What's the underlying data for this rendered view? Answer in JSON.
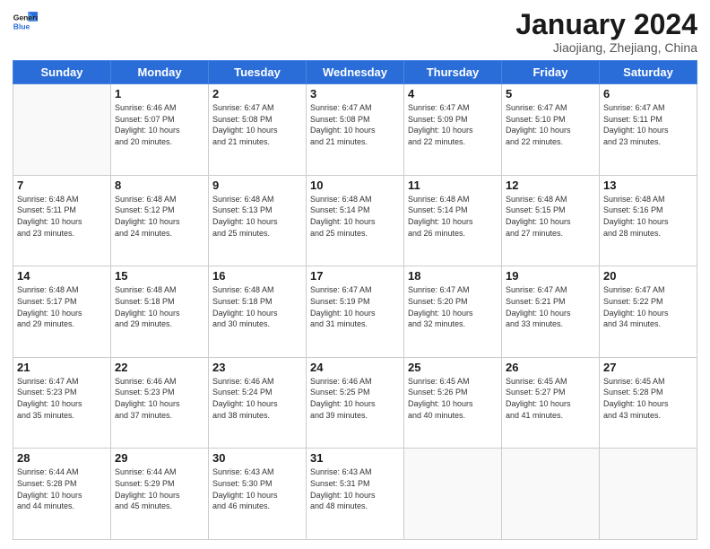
{
  "header": {
    "logo_line1": "General",
    "logo_line2": "Blue",
    "month_title": "January 2024",
    "location": "Jiaojiang, Zhejiang, China"
  },
  "days_of_week": [
    "Sunday",
    "Monday",
    "Tuesday",
    "Wednesday",
    "Thursday",
    "Friday",
    "Saturday"
  ],
  "weeks": [
    [
      {
        "day": "",
        "info": ""
      },
      {
        "day": "1",
        "info": "Sunrise: 6:46 AM\nSunset: 5:07 PM\nDaylight: 10 hours\nand 20 minutes."
      },
      {
        "day": "2",
        "info": "Sunrise: 6:47 AM\nSunset: 5:08 PM\nDaylight: 10 hours\nand 21 minutes."
      },
      {
        "day": "3",
        "info": "Sunrise: 6:47 AM\nSunset: 5:08 PM\nDaylight: 10 hours\nand 21 minutes."
      },
      {
        "day": "4",
        "info": "Sunrise: 6:47 AM\nSunset: 5:09 PM\nDaylight: 10 hours\nand 22 minutes."
      },
      {
        "day": "5",
        "info": "Sunrise: 6:47 AM\nSunset: 5:10 PM\nDaylight: 10 hours\nand 22 minutes."
      },
      {
        "day": "6",
        "info": "Sunrise: 6:47 AM\nSunset: 5:11 PM\nDaylight: 10 hours\nand 23 minutes."
      }
    ],
    [
      {
        "day": "7",
        "info": "Sunrise: 6:48 AM\nSunset: 5:11 PM\nDaylight: 10 hours\nand 23 minutes."
      },
      {
        "day": "8",
        "info": "Sunrise: 6:48 AM\nSunset: 5:12 PM\nDaylight: 10 hours\nand 24 minutes."
      },
      {
        "day": "9",
        "info": "Sunrise: 6:48 AM\nSunset: 5:13 PM\nDaylight: 10 hours\nand 25 minutes."
      },
      {
        "day": "10",
        "info": "Sunrise: 6:48 AM\nSunset: 5:14 PM\nDaylight: 10 hours\nand 25 minutes."
      },
      {
        "day": "11",
        "info": "Sunrise: 6:48 AM\nSunset: 5:14 PM\nDaylight: 10 hours\nand 26 minutes."
      },
      {
        "day": "12",
        "info": "Sunrise: 6:48 AM\nSunset: 5:15 PM\nDaylight: 10 hours\nand 27 minutes."
      },
      {
        "day": "13",
        "info": "Sunrise: 6:48 AM\nSunset: 5:16 PM\nDaylight: 10 hours\nand 28 minutes."
      }
    ],
    [
      {
        "day": "14",
        "info": "Sunrise: 6:48 AM\nSunset: 5:17 PM\nDaylight: 10 hours\nand 29 minutes."
      },
      {
        "day": "15",
        "info": "Sunrise: 6:48 AM\nSunset: 5:18 PM\nDaylight: 10 hours\nand 29 minutes."
      },
      {
        "day": "16",
        "info": "Sunrise: 6:48 AM\nSunset: 5:18 PM\nDaylight: 10 hours\nand 30 minutes."
      },
      {
        "day": "17",
        "info": "Sunrise: 6:47 AM\nSunset: 5:19 PM\nDaylight: 10 hours\nand 31 minutes."
      },
      {
        "day": "18",
        "info": "Sunrise: 6:47 AM\nSunset: 5:20 PM\nDaylight: 10 hours\nand 32 minutes."
      },
      {
        "day": "19",
        "info": "Sunrise: 6:47 AM\nSunset: 5:21 PM\nDaylight: 10 hours\nand 33 minutes."
      },
      {
        "day": "20",
        "info": "Sunrise: 6:47 AM\nSunset: 5:22 PM\nDaylight: 10 hours\nand 34 minutes."
      }
    ],
    [
      {
        "day": "21",
        "info": "Sunrise: 6:47 AM\nSunset: 5:23 PM\nDaylight: 10 hours\nand 35 minutes."
      },
      {
        "day": "22",
        "info": "Sunrise: 6:46 AM\nSunset: 5:23 PM\nDaylight: 10 hours\nand 37 minutes."
      },
      {
        "day": "23",
        "info": "Sunrise: 6:46 AM\nSunset: 5:24 PM\nDaylight: 10 hours\nand 38 minutes."
      },
      {
        "day": "24",
        "info": "Sunrise: 6:46 AM\nSunset: 5:25 PM\nDaylight: 10 hours\nand 39 minutes."
      },
      {
        "day": "25",
        "info": "Sunrise: 6:45 AM\nSunset: 5:26 PM\nDaylight: 10 hours\nand 40 minutes."
      },
      {
        "day": "26",
        "info": "Sunrise: 6:45 AM\nSunset: 5:27 PM\nDaylight: 10 hours\nand 41 minutes."
      },
      {
        "day": "27",
        "info": "Sunrise: 6:45 AM\nSunset: 5:28 PM\nDaylight: 10 hours\nand 43 minutes."
      }
    ],
    [
      {
        "day": "28",
        "info": "Sunrise: 6:44 AM\nSunset: 5:28 PM\nDaylight: 10 hours\nand 44 minutes."
      },
      {
        "day": "29",
        "info": "Sunrise: 6:44 AM\nSunset: 5:29 PM\nDaylight: 10 hours\nand 45 minutes."
      },
      {
        "day": "30",
        "info": "Sunrise: 6:43 AM\nSunset: 5:30 PM\nDaylight: 10 hours\nand 46 minutes."
      },
      {
        "day": "31",
        "info": "Sunrise: 6:43 AM\nSunset: 5:31 PM\nDaylight: 10 hours\nand 48 minutes."
      },
      {
        "day": "",
        "info": ""
      },
      {
        "day": "",
        "info": ""
      },
      {
        "day": "",
        "info": ""
      }
    ]
  ]
}
